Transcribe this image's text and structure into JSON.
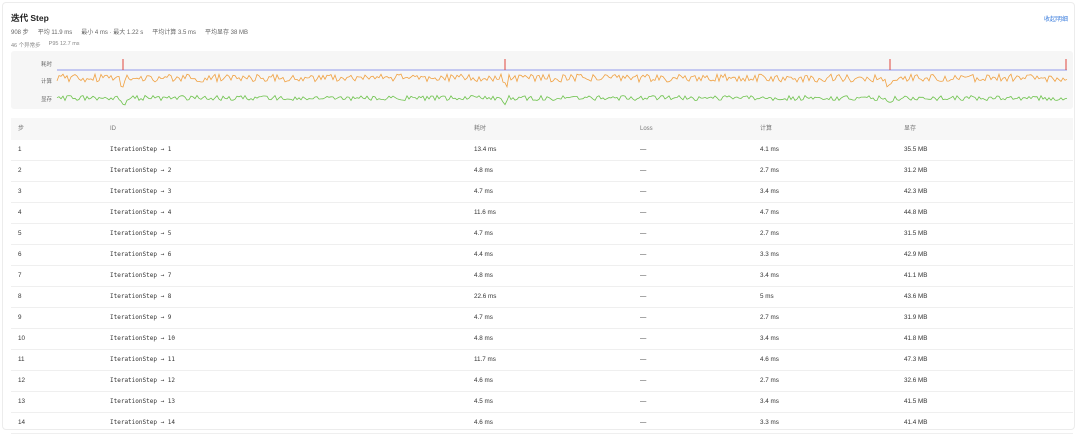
{
  "header": {
    "title": "迭代 Step",
    "collapse_label": "收起明细"
  },
  "stats": {
    "count": "908 步",
    "avg": "平均 11.9 ms",
    "range": "最小 4 ms · 最大 1.22 s",
    "avg_compute": "平均计算 3.5 ms",
    "avg_memory": "平均显存 38 MB"
  },
  "stats2": {
    "anomaly": "46 个异常步",
    "p95": "P95 12.7 ms"
  },
  "sparklines": {
    "labels": [
      "耗时",
      "计算",
      "显存"
    ],
    "colors": {
      "time": "#6f7ce8",
      "spike": "#e0463f",
      "compute": "#f0a040",
      "memory": "#6cc24a"
    }
  },
  "table": {
    "headers": {
      "step": "步",
      "id": "ID",
      "time": "耗时",
      "loss": "Loss",
      "compute": "计算",
      "memory": "显存"
    },
    "rows": [
      {
        "step": "1",
        "id": "IterationStep → 1",
        "time": "13.4 ms",
        "loss": "—",
        "compute": "4.1 ms",
        "memory": "35.5 MB"
      },
      {
        "step": "2",
        "id": "IterationStep → 2",
        "time": "4.8 ms",
        "loss": "—",
        "compute": "2.7 ms",
        "memory": "31.2 MB"
      },
      {
        "step": "3",
        "id": "IterationStep → 3",
        "time": "4.7 ms",
        "loss": "—",
        "compute": "3.4 ms",
        "memory": "42.3 MB"
      },
      {
        "step": "4",
        "id": "IterationStep → 4",
        "time": "11.6 ms",
        "loss": "—",
        "compute": "4.7 ms",
        "memory": "44.8 MB"
      },
      {
        "step": "5",
        "id": "IterationStep → 5",
        "time": "4.7 ms",
        "loss": "—",
        "compute": "2.7 ms",
        "memory": "31.5 MB"
      },
      {
        "step": "6",
        "id": "IterationStep → 6",
        "time": "4.4 ms",
        "loss": "—",
        "compute": "3.3 ms",
        "memory": "42.9 MB"
      },
      {
        "step": "7",
        "id": "IterationStep → 7",
        "time": "4.8 ms",
        "loss": "—",
        "compute": "3.4 ms",
        "memory": "41.1 MB"
      },
      {
        "step": "8",
        "id": "IterationStep → 8",
        "time": "22.6 ms",
        "loss": "—",
        "compute": "5 ms",
        "memory": "43.6 MB"
      },
      {
        "step": "9",
        "id": "IterationStep → 9",
        "time": "4.7 ms",
        "loss": "—",
        "compute": "2.7 ms",
        "memory": "31.9 MB"
      },
      {
        "step": "10",
        "id": "IterationStep → 10",
        "time": "4.8 ms",
        "loss": "—",
        "compute": "3.4 ms",
        "memory": "41.8 MB"
      },
      {
        "step": "11",
        "id": "IterationStep → 11",
        "time": "11.7 ms",
        "loss": "—",
        "compute": "4.6 ms",
        "memory": "47.3 MB"
      },
      {
        "step": "12",
        "id": "IterationStep → 12",
        "time": "4.6 ms",
        "loss": "—",
        "compute": "2.7 ms",
        "memory": "32.6 MB"
      },
      {
        "step": "13",
        "id": "IterationStep → 13",
        "time": "4.5 ms",
        "loss": "—",
        "compute": "3.4 ms",
        "memory": "41.5 MB"
      },
      {
        "step": "14",
        "id": "IterationStep → 14",
        "time": "4.6 ms",
        "loss": "—",
        "compute": "3.3 ms",
        "memory": "41.4 MB"
      }
    ]
  }
}
